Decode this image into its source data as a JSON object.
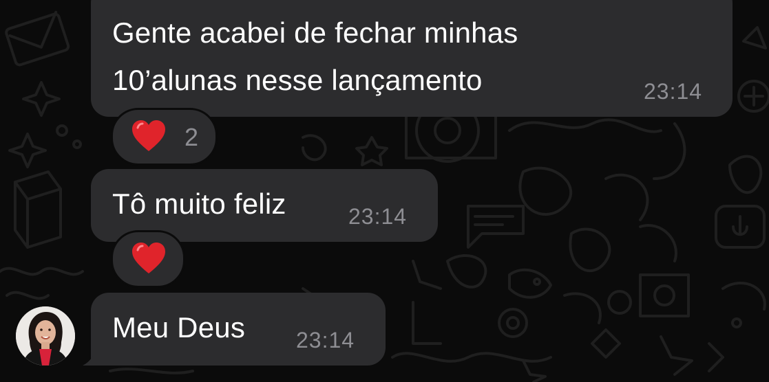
{
  "messages": [
    {
      "text_line1": "Gente acabei de fechar minhas",
      "text_line2": "10’alunas nesse lançamento",
      "time": "23:14",
      "reaction": {
        "emoji": "heart",
        "count": "2"
      }
    },
    {
      "text": "Tô muito feliz",
      "time": "23:14",
      "reaction": {
        "emoji": "heart"
      }
    },
    {
      "text": "Meu Deus",
      "time": "23:14"
    }
  ],
  "colors": {
    "background": "#0b0b0b",
    "bubble": "#2c2c2e",
    "text": "#ffffff",
    "timestamp": "#8e8e93",
    "heart": "#e0242b"
  },
  "icons": [
    "heart-icon",
    "avatar",
    "chat-wallpaper-doodles"
  ]
}
